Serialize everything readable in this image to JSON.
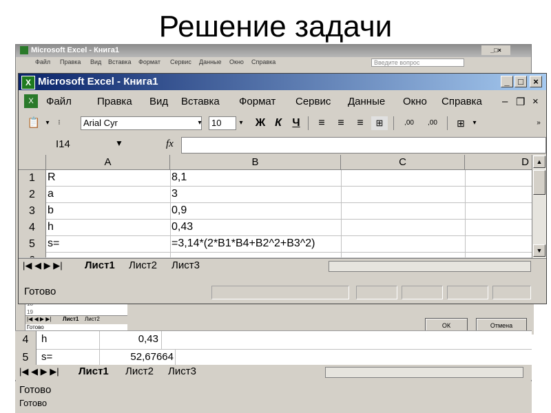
{
  "slide_title": "Решение задачи",
  "back_window": {
    "title": "Microsoft Excel - Книга1",
    "menu": [
      "Файл",
      "Правка",
      "Вид",
      "Вставка",
      "Формат",
      "Сервис",
      "Данные",
      "Окно",
      "Справка"
    ],
    "question_placeholder": "Введите вопрос",
    "rows": [
      {
        "num": "4",
        "a": "h",
        "b": "0,43"
      },
      {
        "num": "5",
        "a": "s=",
        "b": "52,67664"
      }
    ],
    "sheet_tabs": [
      "Лист1",
      "Лист2",
      "Лист3"
    ],
    "status": "Готово",
    "status_back": "Готово"
  },
  "mini_window": {
    "row_nums": [
      "18",
      "19"
    ],
    "sheet_tabs": [
      "Лист1",
      "Лист2"
    ],
    "status": "Готово"
  },
  "dialog": {
    "ok_label": "ОК",
    "cancel_label": "Отмена"
  },
  "main_window": {
    "title": "Microsoft Excel - Книга1",
    "menu": [
      "Файл",
      "Правка",
      "Вид",
      "Вставка",
      "Формат",
      "Сервис",
      "Данные",
      "Окно",
      "Справка"
    ],
    "font_name": "Arial Cyr",
    "font_size": "10",
    "toolbar_bold": "Ж",
    "toolbar_italic": "К",
    "toolbar_underline": "Ч",
    "toolbar_inc_dec": ",00",
    "toolbar_dec_dec": ",00",
    "name_box": "I14",
    "fx_label": "fx",
    "columns": [
      "A",
      "B",
      "C",
      "D"
    ],
    "rows": [
      {
        "num": "1",
        "a": "R",
        "b": "8,1"
      },
      {
        "num": "2",
        "a": "a",
        "b": "3"
      },
      {
        "num": "3",
        "a": "b",
        "b": "0,9"
      },
      {
        "num": "4",
        "a": "h",
        "b": "0,43"
      },
      {
        "num": "5",
        "a": "s=",
        "b": "=3,14*(2*B1*B4+B2^2+B3^2)"
      },
      {
        "num": "6",
        "a": "",
        "b": ""
      }
    ],
    "sheet_tabs": [
      "Лист1",
      "Лист2",
      "Лист3"
    ],
    "status": "Готово"
  },
  "colors": {
    "title_active_start": "#0a246a",
    "title_active_end": "#a6caf0",
    "chrome": "#d4d0c8"
  }
}
